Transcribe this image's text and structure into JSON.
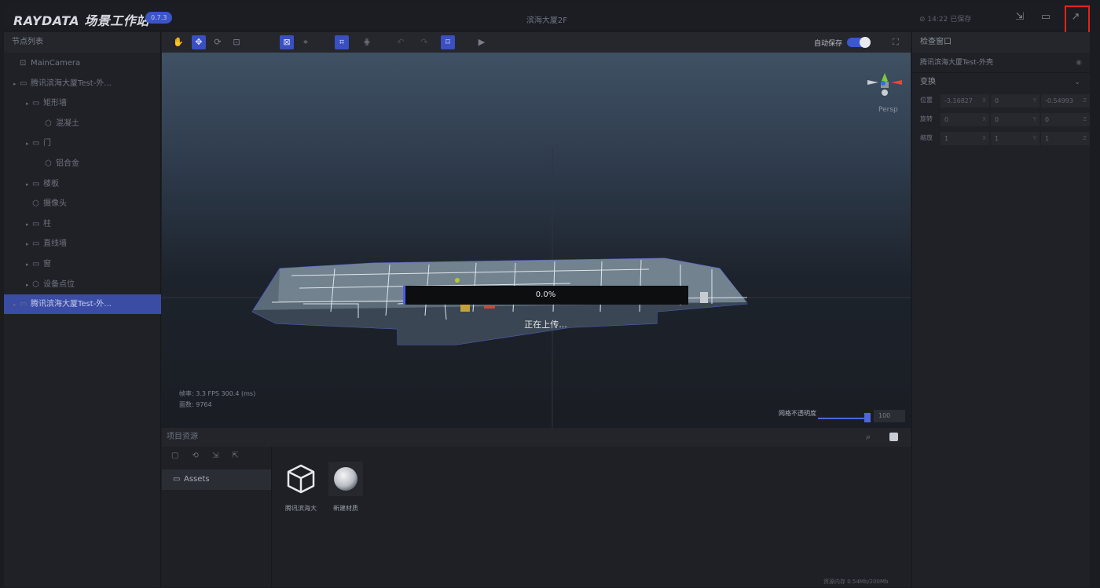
{
  "topbar": {
    "logo": "RAYDATA 场景工作站",
    "version": "0.7.3",
    "scene_title": "滨海大厦2F",
    "save_status": "⊘ 14:22 已保存",
    "publish_tooltip": "发布"
  },
  "left_panel": {
    "title": "节点列表",
    "tree": [
      {
        "label": "MainCamera",
        "icon": "camera-icon",
        "depth": 0,
        "arrow": false
      },
      {
        "label": "腾讯滨海大厦Test-外...",
        "icon": "folder-icon",
        "depth": 0,
        "arrow": true
      },
      {
        "label": "矩形墙",
        "icon": "folder-icon",
        "depth": 1,
        "arrow": true
      },
      {
        "label": "混凝土",
        "icon": "material-icon",
        "depth": 2,
        "arrow": false
      },
      {
        "label": "门",
        "icon": "folder-icon",
        "depth": 1,
        "arrow": true
      },
      {
        "label": "铝合金",
        "icon": "material-icon",
        "depth": 2,
        "arrow": false
      },
      {
        "label": "楼板",
        "icon": "folder-icon",
        "depth": 1,
        "arrow": true
      },
      {
        "label": "摄像头",
        "icon": "material-icon",
        "depth": 1,
        "arrow": false
      },
      {
        "label": "柱",
        "icon": "folder-icon",
        "depth": 1,
        "arrow": true
      },
      {
        "label": "直线墙",
        "icon": "folder-icon",
        "depth": 1,
        "arrow": true
      },
      {
        "label": "窗",
        "icon": "folder-icon",
        "depth": 1,
        "arrow": true
      },
      {
        "label": "设备点位",
        "icon": "material-icon",
        "depth": 1,
        "arrow": true
      },
      {
        "label": "腾讯滨海大厦Test-外...",
        "icon": "folder-icon",
        "depth": 0,
        "arrow": true,
        "selected": true
      }
    ]
  },
  "toolbar": {
    "autosave_label": "自动保存",
    "autosave_on": true
  },
  "viewport": {
    "fps": "帧率: 3.3 FPS 300.4 (ms)",
    "faces": "面数: 9764",
    "camera_mode": "Persp",
    "grid_label": "网格不透明度",
    "grid_value": "100",
    "upload_progress": "0.0%",
    "upload_progress_value": 0.0,
    "upload_status": "正在上传..."
  },
  "assets": {
    "title": "项目资源",
    "folder": "Assets",
    "items": [
      {
        "label": "腾讯滨海大",
        "icon": "model-cube-icon"
      },
      {
        "label": "新建材质",
        "icon": "material-sphere-icon"
      }
    ],
    "memory": "资源内存    0.54Mb/200Mb"
  },
  "inspector": {
    "title": "检查窗口",
    "object_name": "腾讯滨海大厦Test-外壳",
    "transform_title": "变换",
    "rows": [
      {
        "label": "位置",
        "x": "-3.16827",
        "y": "0",
        "z": "-0.54993"
      },
      {
        "label": "旋转",
        "x": "0",
        "y": "0",
        "z": "0"
      },
      {
        "label": "缩放",
        "x": "1",
        "y": "1",
        "z": "1"
      }
    ]
  },
  "colors": {
    "accent": "#3a4fc0",
    "highlight": "#e3231d"
  }
}
